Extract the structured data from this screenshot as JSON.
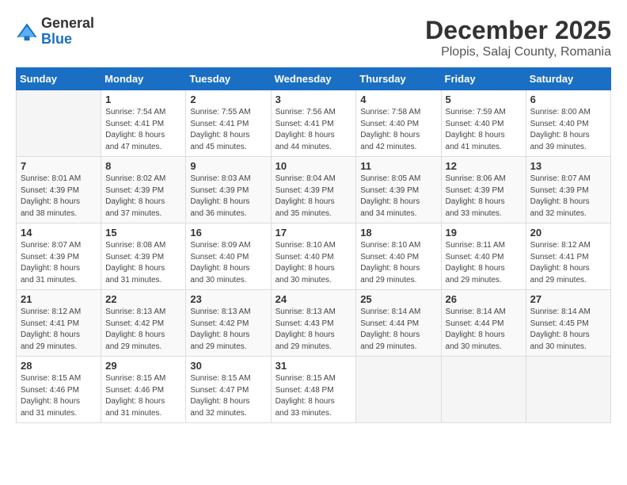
{
  "header": {
    "logo_general": "General",
    "logo_blue": "Blue",
    "month_title": "December 2025",
    "location": "Plopis, Salaj County, Romania"
  },
  "weekdays": [
    "Sunday",
    "Monday",
    "Tuesday",
    "Wednesday",
    "Thursday",
    "Friday",
    "Saturday"
  ],
  "weeks": [
    [
      {
        "day": "",
        "info": ""
      },
      {
        "day": "1",
        "info": "Sunrise: 7:54 AM\nSunset: 4:41 PM\nDaylight: 8 hours\nand 47 minutes."
      },
      {
        "day": "2",
        "info": "Sunrise: 7:55 AM\nSunset: 4:41 PM\nDaylight: 8 hours\nand 45 minutes."
      },
      {
        "day": "3",
        "info": "Sunrise: 7:56 AM\nSunset: 4:41 PM\nDaylight: 8 hours\nand 44 minutes."
      },
      {
        "day": "4",
        "info": "Sunrise: 7:58 AM\nSunset: 4:40 PM\nDaylight: 8 hours\nand 42 minutes."
      },
      {
        "day": "5",
        "info": "Sunrise: 7:59 AM\nSunset: 4:40 PM\nDaylight: 8 hours\nand 41 minutes."
      },
      {
        "day": "6",
        "info": "Sunrise: 8:00 AM\nSunset: 4:40 PM\nDaylight: 8 hours\nand 39 minutes."
      }
    ],
    [
      {
        "day": "7",
        "info": "Sunrise: 8:01 AM\nSunset: 4:39 PM\nDaylight: 8 hours\nand 38 minutes."
      },
      {
        "day": "8",
        "info": "Sunrise: 8:02 AM\nSunset: 4:39 PM\nDaylight: 8 hours\nand 37 minutes."
      },
      {
        "day": "9",
        "info": "Sunrise: 8:03 AM\nSunset: 4:39 PM\nDaylight: 8 hours\nand 36 minutes."
      },
      {
        "day": "10",
        "info": "Sunrise: 8:04 AM\nSunset: 4:39 PM\nDaylight: 8 hours\nand 35 minutes."
      },
      {
        "day": "11",
        "info": "Sunrise: 8:05 AM\nSunset: 4:39 PM\nDaylight: 8 hours\nand 34 minutes."
      },
      {
        "day": "12",
        "info": "Sunrise: 8:06 AM\nSunset: 4:39 PM\nDaylight: 8 hours\nand 33 minutes."
      },
      {
        "day": "13",
        "info": "Sunrise: 8:07 AM\nSunset: 4:39 PM\nDaylight: 8 hours\nand 32 minutes."
      }
    ],
    [
      {
        "day": "14",
        "info": "Sunrise: 8:07 AM\nSunset: 4:39 PM\nDaylight: 8 hours\nand 31 minutes."
      },
      {
        "day": "15",
        "info": "Sunrise: 8:08 AM\nSunset: 4:39 PM\nDaylight: 8 hours\nand 31 minutes."
      },
      {
        "day": "16",
        "info": "Sunrise: 8:09 AM\nSunset: 4:40 PM\nDaylight: 8 hours\nand 30 minutes."
      },
      {
        "day": "17",
        "info": "Sunrise: 8:10 AM\nSunset: 4:40 PM\nDaylight: 8 hours\nand 30 minutes."
      },
      {
        "day": "18",
        "info": "Sunrise: 8:10 AM\nSunset: 4:40 PM\nDaylight: 8 hours\nand 29 minutes."
      },
      {
        "day": "19",
        "info": "Sunrise: 8:11 AM\nSunset: 4:40 PM\nDaylight: 8 hours\nand 29 minutes."
      },
      {
        "day": "20",
        "info": "Sunrise: 8:12 AM\nSunset: 4:41 PM\nDaylight: 8 hours\nand 29 minutes."
      }
    ],
    [
      {
        "day": "21",
        "info": "Sunrise: 8:12 AM\nSunset: 4:41 PM\nDaylight: 8 hours\nand 29 minutes."
      },
      {
        "day": "22",
        "info": "Sunrise: 8:13 AM\nSunset: 4:42 PM\nDaylight: 8 hours\nand 29 minutes."
      },
      {
        "day": "23",
        "info": "Sunrise: 8:13 AM\nSunset: 4:42 PM\nDaylight: 8 hours\nand 29 minutes."
      },
      {
        "day": "24",
        "info": "Sunrise: 8:13 AM\nSunset: 4:43 PM\nDaylight: 8 hours\nand 29 minutes."
      },
      {
        "day": "25",
        "info": "Sunrise: 8:14 AM\nSunset: 4:44 PM\nDaylight: 8 hours\nand 29 minutes."
      },
      {
        "day": "26",
        "info": "Sunrise: 8:14 AM\nSunset: 4:44 PM\nDaylight: 8 hours\nand 30 minutes."
      },
      {
        "day": "27",
        "info": "Sunrise: 8:14 AM\nSunset: 4:45 PM\nDaylight: 8 hours\nand 30 minutes."
      }
    ],
    [
      {
        "day": "28",
        "info": "Sunrise: 8:15 AM\nSunset: 4:46 PM\nDaylight: 8 hours\nand 31 minutes."
      },
      {
        "day": "29",
        "info": "Sunrise: 8:15 AM\nSunset: 4:46 PM\nDaylight: 8 hours\nand 31 minutes."
      },
      {
        "day": "30",
        "info": "Sunrise: 8:15 AM\nSunset: 4:47 PM\nDaylight: 8 hours\nand 32 minutes."
      },
      {
        "day": "31",
        "info": "Sunrise: 8:15 AM\nSunset: 4:48 PM\nDaylight: 8 hours\nand 33 minutes."
      },
      {
        "day": "",
        "info": ""
      },
      {
        "day": "",
        "info": ""
      },
      {
        "day": "",
        "info": ""
      }
    ]
  ]
}
